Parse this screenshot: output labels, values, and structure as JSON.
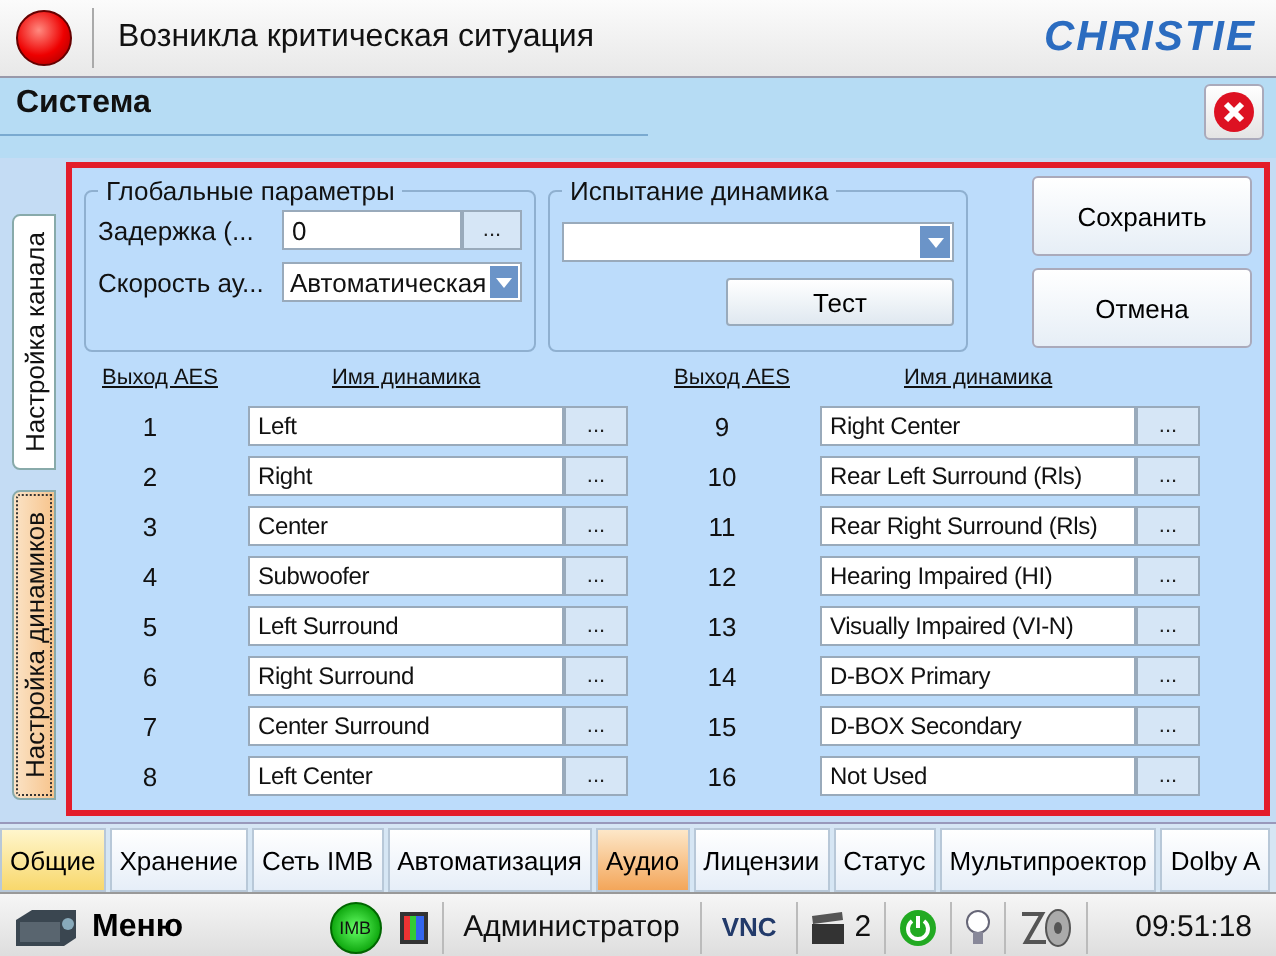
{
  "alert_bar": {
    "title": "Возникла критическая ситуация",
    "logo": "CHRISTIE"
  },
  "window": {
    "title": "Система"
  },
  "side_tabs": [
    {
      "label": "Настройка канала",
      "selected": false
    },
    {
      "label": "Настройка динамиков",
      "selected": true
    }
  ],
  "global_params": {
    "title": "Глобальные параметры",
    "delay_label": "Задержка (...",
    "delay_value": "0",
    "delay_button": "...",
    "speed_label": "Скорость ау...",
    "speed_value": "Автоматическая"
  },
  "speaker_test": {
    "title": "Испытание динамика",
    "test_button": "Тест"
  },
  "actions": [
    "Сохранить",
    "Отмена"
  ],
  "speaker_columns": [
    {
      "output_header": "Выход AES",
      "name_header": "Имя динамика",
      "rows": [
        {
          "output": "1",
          "name": "Left",
          "button": "..."
        },
        {
          "output": "2",
          "name": "Right",
          "button": "..."
        },
        {
          "output": "3",
          "name": "Center",
          "button": "..."
        },
        {
          "output": "4",
          "name": "Subwoofer",
          "button": "..."
        },
        {
          "output": "5",
          "name": "Left Surround",
          "button": "..."
        },
        {
          "output": "6",
          "name": "Right Surround",
          "button": "..."
        },
        {
          "output": "7",
          "name": "Center Surround",
          "button": "..."
        },
        {
          "output": "8",
          "name": "Left Center",
          "button": "..."
        }
      ]
    },
    {
      "output_header": "Выход AES",
      "name_header": "Имя динамика",
      "rows": [
        {
          "output": "9",
          "name": "Right Center",
          "button": "..."
        },
        {
          "output": "10",
          "name": "Rear Left Surround (Rls)",
          "button": "..."
        },
        {
          "output": "11",
          "name": "Rear Right Surround (Rls)",
          "button": "..."
        },
        {
          "output": "12",
          "name": "Hearing Impaired (HI)",
          "button": "..."
        },
        {
          "output": "13",
          "name": "Visually Impaired (VI-N)",
          "button": "..."
        },
        {
          "output": "14",
          "name": "D-BOX Primary",
          "button": "..."
        },
        {
          "output": "15",
          "name": "D-BOX Secondary",
          "button": "..."
        },
        {
          "output": "16",
          "name": "Not Used",
          "button": "..."
        }
      ]
    }
  ],
  "bottom_tabs": [
    {
      "label": "Общие",
      "selected": false,
      "highlighted": true
    },
    {
      "label": "Хранение",
      "selected": false,
      "highlighted": false
    },
    {
      "label": "Сеть IMB",
      "selected": false,
      "highlighted": false
    },
    {
      "label": "Автоматизация",
      "selected": false,
      "highlighted": false
    },
    {
      "label": "Аудио",
      "selected": true,
      "highlighted": false
    },
    {
      "label": "Лицензии",
      "selected": false,
      "highlighted": false
    },
    {
      "label": "Статус",
      "selected": false,
      "highlighted": false
    },
    {
      "label": "Мультипроектор",
      "selected": false,
      "highlighted": false
    },
    {
      "label": "Dolby A",
      "selected": false,
      "highlighted": false
    }
  ],
  "status_bar": {
    "menu": "Меню",
    "imb_badge": "IMB",
    "user": "Администратор",
    "vnc": "VNC",
    "clip_count": "2",
    "time": "09:51:18"
  }
}
